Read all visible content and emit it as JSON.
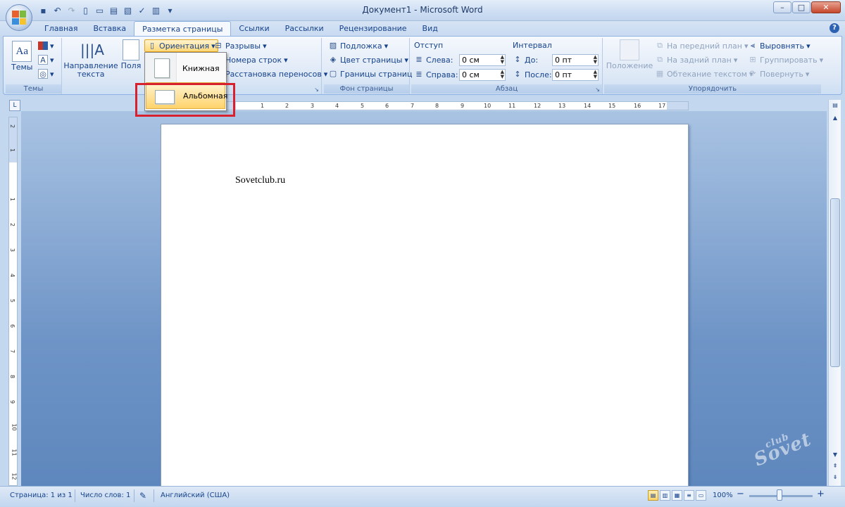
{
  "window": {
    "title": "Документ1 - Microsoft Word",
    "controls": [
      "–",
      "□",
      "✕"
    ]
  },
  "qat_icons": [
    "save-icon",
    "undo-icon",
    "redo-icon",
    "new-icon",
    "open-icon",
    "print-icon",
    "preview-icon",
    "spelling-icon",
    "quickprint-icon"
  ],
  "tabs": [
    "Главная",
    "Вставка",
    "Разметка страницы",
    "Ссылки",
    "Рассылки",
    "Рецензирование",
    "Вид"
  ],
  "active_tab": "Разметка страницы",
  "ribbon": {
    "themes": {
      "label": "Темы",
      "button": "Темы"
    },
    "page_setup": {
      "text_direction": "Направление текста",
      "text_direction_1": "Направление",
      "text_direction_2": "текста",
      "margins": "Поля",
      "orientation": "Ориентация",
      "breaks": "Разрывы",
      "line_numbers": "Номера строк",
      "hyphenation": "Расстановка переносов"
    },
    "page_background": {
      "label": "Фон страницы",
      "watermark": "Подложка",
      "page_color": "Цвет страницы",
      "page_borders": "Границы страниц"
    },
    "paragraph": {
      "label": "Абзац",
      "indent_header": "Отступ",
      "left_label": "Слева:",
      "left_value": "0 см",
      "right_label": "Справа:",
      "right_value": "0 см",
      "spacing_header": "Интервал",
      "before_label": "До:",
      "before_value": "0 пт",
      "after_label": "После:",
      "after_value": "0 пт"
    },
    "arrange": {
      "label": "Упорядочить",
      "position": "Положение",
      "bring_front": "На передний план",
      "send_back": "На задний план",
      "text_wrap": "Обтекание текстом",
      "align": "Выровнять",
      "group": "Группировать",
      "rotate": "Повернуть"
    }
  },
  "orientation_menu": {
    "portrait": "Книжная",
    "landscape": "Альбомная"
  },
  "ruler_numbers": [
    "1",
    "2",
    "3",
    "4",
    "5",
    "6",
    "7",
    "8",
    "9",
    "10",
    "11",
    "12",
    "13",
    "14",
    "15",
    "16",
    "17"
  ],
  "vruler_numbers": [
    "2",
    "1",
    "1",
    "2",
    "3",
    "4",
    "5",
    "6",
    "7",
    "8",
    "9",
    "10",
    "11",
    "12"
  ],
  "document": {
    "text": "Sovetclub.ru"
  },
  "watermark": {
    "small": "club",
    "big": "Sovet"
  },
  "status": {
    "page": "Страница: 1 из 1",
    "words": "Число слов: 1",
    "language": "Английский (США)",
    "zoom": "100%",
    "zoom_minus": "−",
    "zoom_plus": "+"
  },
  "colors": {
    "accent": "#15428b",
    "highlight": "#d8212f",
    "menu_hover": "#ffd36b"
  }
}
